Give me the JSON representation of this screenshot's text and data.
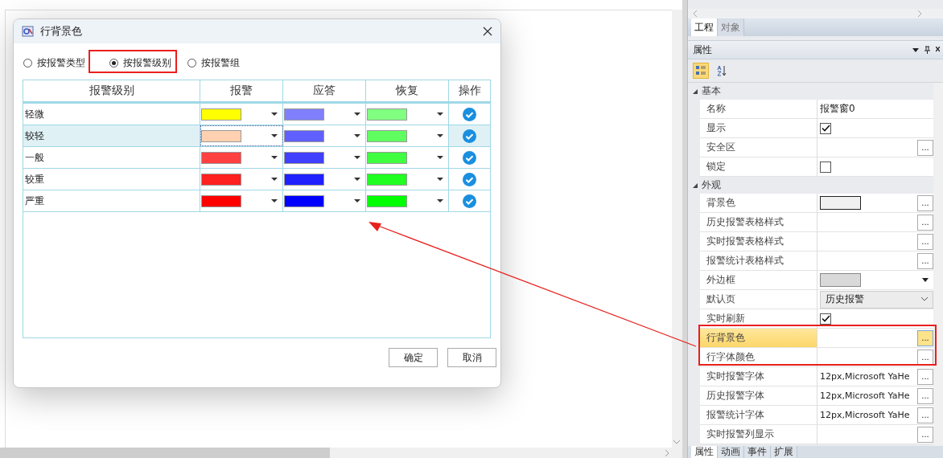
{
  "dialog": {
    "title": "行背景色",
    "radios": [
      {
        "label": "按报警类型",
        "selected": false
      },
      {
        "label": "按报警级别",
        "selected": true
      },
      {
        "label": "按报警组",
        "selected": false
      }
    ],
    "table": {
      "columns": [
        "报警级别",
        "报警",
        "应答",
        "恢复",
        "操作"
      ],
      "rows": [
        {
          "level": "轻微",
          "selected": false,
          "swatches": [
            {
              "color": "#ffff00"
            },
            {
              "color": "#8080ff"
            },
            {
              "color": "#80ff80"
            }
          ]
        },
        {
          "level": "较轻",
          "selected": true,
          "swatches": [
            {
              "color": "#ffd1b0"
            },
            {
              "color": "#6060ff"
            },
            {
              "color": "#60ff60"
            }
          ]
        },
        {
          "level": "一般",
          "selected": false,
          "swatches": [
            {
              "color": "#ff4040"
            },
            {
              "color": "#4040ff"
            },
            {
              "color": "#40ff40"
            }
          ]
        },
        {
          "level": "较重",
          "selected": false,
          "swatches": [
            {
              "color": "#ff2020"
            },
            {
              "color": "#2020ff"
            },
            {
              "color": "#20ff20"
            }
          ]
        },
        {
          "level": "严重",
          "selected": false,
          "swatches": [
            {
              "color": "#ff0000"
            },
            {
              "color": "#0000ff"
            },
            {
              "color": "#00ff00"
            }
          ]
        }
      ]
    },
    "buttons": [
      "确定",
      "取消"
    ]
  },
  "panel": {
    "tabs": [
      {
        "label": "工程",
        "selected": true
      },
      {
        "label": "对象",
        "selected": false
      }
    ],
    "title": "属性",
    "view_buttons": [
      {
        "kind": "categorized",
        "selected": true
      },
      {
        "kind": "alphabetical",
        "selected": false
      }
    ],
    "sections": [
      {
        "title": "基本",
        "expanded": true,
        "properties": [
          {
            "name": "名称",
            "kind": "text",
            "value": "报警窗0",
            "selected": false
          },
          {
            "name": "显示",
            "kind": "checkbox",
            "checked": true,
            "selected": false
          },
          {
            "name": "安全区",
            "kind": "button",
            "button": "...",
            "selected": false
          },
          {
            "name": "锁定",
            "kind": "checkbox",
            "checked": false,
            "selected": false
          }
        ]
      },
      {
        "title": "外观",
        "expanded": true,
        "properties": [
          {
            "name": "背景色",
            "kind": "color",
            "color": "#f0f0f0",
            "button": "...",
            "selected": false
          },
          {
            "name": "历史报警表格样式",
            "kind": "button",
            "button": "...",
            "selected": false
          },
          {
            "name": "实时报警表格样式",
            "kind": "button",
            "button": "...",
            "selected": false
          },
          {
            "name": "报警统计表格样式",
            "kind": "button",
            "button": "...",
            "selected": false
          },
          {
            "name": "外边框",
            "kind": "color-dropdown",
            "color": "#d9d9d9",
            "selected": false
          },
          {
            "name": "默认页",
            "kind": "select",
            "value": "历史报警",
            "selected": false
          },
          {
            "name": "实时刷新",
            "kind": "checkbox",
            "checked": true,
            "selected": false
          },
          {
            "name": "行背景色",
            "kind": "button",
            "button": "...",
            "selected": true
          },
          {
            "name": "行字体颜色",
            "kind": "button",
            "button": "...",
            "selected": false
          },
          {
            "name": "实时报警字体",
            "kind": "font",
            "value": "12px,Microsoft YaHe",
            "button": "...",
            "selected": false
          },
          {
            "name": "历史报警字体",
            "kind": "font",
            "value": "12px,Microsoft YaHe",
            "button": "...",
            "selected": false
          },
          {
            "name": "报警统计字体",
            "kind": "font",
            "value": "12px,Microsoft YaHe",
            "button": "...",
            "selected": false
          },
          {
            "name": "实时报警列显示",
            "kind": "button",
            "button": "...",
            "selected": false
          }
        ]
      }
    ],
    "bottom_tabs": [
      {
        "label": "属性",
        "selected": true
      },
      {
        "label": "动画",
        "selected": false
      },
      {
        "label": "事件",
        "selected": false
      },
      {
        "label": "扩展",
        "selected": false
      }
    ]
  }
}
